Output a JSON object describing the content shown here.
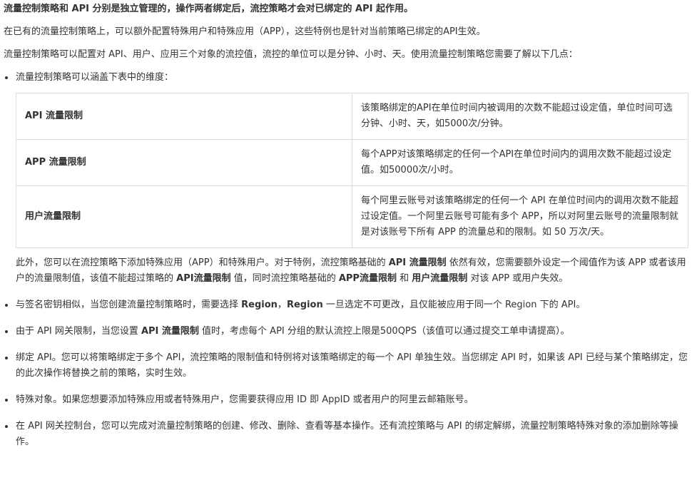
{
  "title": "流量控制策略和 API 分别是独立管理的，操作两者绑定后，流控策略才会对已绑定的 API 起作用。",
  "intro1": "在已有的流量控制策略上，可以额外配置特殊用户和特殊应用（APP），这些特例也是针对当前策略已绑定的API生效。",
  "intro2": "流量控制策略可以配置对 API、用户、应用三个对象的流控值，流控的单位可以是分钟、小时、天。使用流量控制策略您需要了解以下几点：",
  "bullet1": {
    "lead": "流量控制策略可以涵盖下表中的维度：",
    "table": [
      {
        "key": "API 流量限制",
        "desc": "该策略绑定的API在单位时间内被调用的次数不能超过设定值，单位时间可选分钟、小时、天，如5000次/分钟。"
      },
      {
        "key": "APP 流量限制",
        "desc": "每个APP对该策略绑定的任何一个API在单位时间内的调用次数不能超过设定值。如50000次/小时。"
      },
      {
        "key": "用户流量限制",
        "desc": "每个阿里云账号对该策略绑定的任何一个 API 在单位时间内的调用次数不能超过设定值。一个阿里云账号可能有多个 APP，所以对阿里云账号的流量限制就是对该账号下所有 APP 的流量总和的限制。如 50 万次/天。"
      }
    ],
    "note": {
      "t1": "此外，您可以在流控策略下添加特殊应用（APP）和特殊用户。对于特例，流控策略基础的 ",
      "b1": "API 流量限制",
      "t2": " 依然有效，您需要额外设定一个阈值作为该 APP 或者该用户的流量限制值，该值不能超过策略的 ",
      "b2": "API流量限制",
      "t3": " 值，同时流控策略基础的 ",
      "b3": "APP流量限制",
      "t4": " 和 ",
      "b4": "用户流量限制",
      "t5": " 对该 APP 或用户失效。"
    }
  },
  "bullet2": {
    "t1": "与签名密钥相似，当您创建流量控制策略时，需要选择 ",
    "b1": "Region",
    "t2": "，",
    "b2": "Region",
    "t3": " 一旦选定不可更改，且仅能被应用于同一个 Region 下的 API。"
  },
  "bullet3": {
    "t1": "由于 API 网关限制，当您设置 ",
    "b1": "API 流量限制",
    "t2": " 值时，考虑每个 API 分组的默认流控上限是500QPS（该值可以通过提交工单申请提高）。"
  },
  "bullet4": "绑定 API。您可以将策略绑定于多个 API，流控策略的限制值和特例将对该策略绑定的每一个 API 单独生效。当您绑定 API 时，如果该 API 已经与某个策略绑定，您的此次操作将替换之前的策略，实时生效。",
  "bullet5": "特殊对象。如果您想要添加特殊应用或者特殊用户，您需要获得应用 ID 即 AppID 或者用户的阿里云邮箱账号。",
  "bullet6": "在 API 网关控制台，您可以完成对流量控制策略的创建、修改、删除、查看等基本操作。还有流控策略与 API 的绑定解绑，流量控制策略特殊对象的添加删除等操作。"
}
